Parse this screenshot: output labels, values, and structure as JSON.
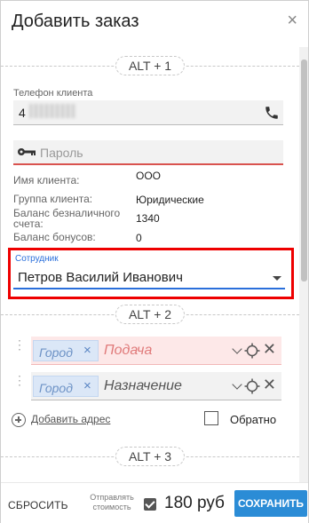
{
  "dialog": {
    "title": "Добавить заказ",
    "close_symbol": "×"
  },
  "sections": {
    "alt1": "ALT + 1",
    "alt2": "ALT + 2",
    "alt3": "ALT + 3"
  },
  "phone": {
    "label": "Телефон клиента",
    "value_visible": "4",
    "icon": "phone-icon"
  },
  "password": {
    "placeholder": "Пароль",
    "icon": "key-icon"
  },
  "client_info": {
    "name_label": "Имя клиента:",
    "name_value": "ООО",
    "group_label": "Группа клиента:",
    "group_value": "Юридические",
    "balance_label_line1": "Баланс безналичного",
    "balance_label_line2": "счета:",
    "balance_value": "1340",
    "bonus_label": "Баланс бонусов:",
    "bonus_value": "0"
  },
  "employee": {
    "label": "Сотрудник",
    "value": "Петров Василий Иванович"
  },
  "addresses": [
    {
      "city": "Город",
      "placeholder": "Подача",
      "state": "invalid"
    },
    {
      "city": "Город",
      "placeholder": "Назначение",
      "state": "normal"
    }
  ],
  "add_address": {
    "label": "Добавить адрес"
  },
  "return_trip": {
    "label": "Обратно",
    "checked": false
  },
  "footer": {
    "reset_label": "СБРОСИТЬ",
    "send_cost_line1": "Отправлять",
    "send_cost_line2": "стоимость",
    "send_cost_checked": true,
    "price": "180 руб",
    "save_label": "СОХРАНИТЬ"
  },
  "colors": {
    "accent_blue": "#2b8cd6",
    "error_red": "#d9534f",
    "highlight_red": "#e00"
  }
}
